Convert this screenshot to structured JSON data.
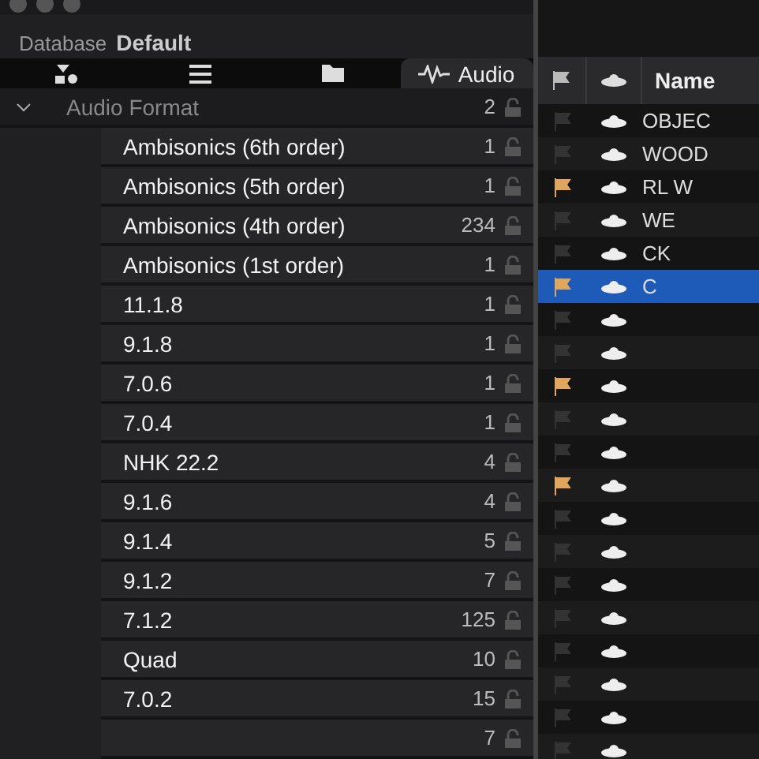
{
  "database": {
    "label": "Database",
    "value": "Default"
  },
  "tabs": [
    {
      "kind": "shapes",
      "selected": false
    },
    {
      "kind": "list",
      "selected": false
    },
    {
      "kind": "folder",
      "selected": false
    },
    {
      "kind": "audio",
      "label": "Audio",
      "selected": true
    }
  ],
  "tree": [
    {
      "label": "Audio Format",
      "count": "2",
      "expanded": true,
      "children": [
        {
          "label": "Ambisonics (6th order)",
          "count": "1"
        },
        {
          "label": "Ambisonics (5th order)",
          "count": "1"
        },
        {
          "label": "Ambisonics (4th order)",
          "count": "234"
        },
        {
          "label": "Ambisonics (1st order)",
          "count": "1"
        },
        {
          "label": "11.1.8",
          "count": "1"
        },
        {
          "label": "9.1.8",
          "count": "1"
        },
        {
          "label": "7.0.6",
          "count": "1"
        },
        {
          "label": "7.0.4",
          "count": "1"
        },
        {
          "label": "NHK 22.2",
          "count": "4"
        },
        {
          "label": "9.1.6",
          "count": "4"
        },
        {
          "label": "9.1.4",
          "count": "5"
        },
        {
          "label": "9.1.2",
          "count": "7"
        },
        {
          "label": "7.1.2",
          "count": "125"
        },
        {
          "label": "Quad",
          "count": "10"
        },
        {
          "label": "7.0.2",
          "count": "15"
        },
        {
          "count": "7"
        }
      ]
    }
  ],
  "table": {
    "columns": [
      {
        "kind": "flag"
      },
      {
        "kind": "cloud"
      },
      {
        "kind": "text",
        "label": "Name"
      }
    ],
    "rows": [
      {
        "flagged": false,
        "name": "OBJEC",
        "selected": false
      },
      {
        "flagged": false,
        "name": "WOOD",
        "selected": false
      },
      {
        "flagged": true,
        "name": "RL W",
        "selected": false
      },
      {
        "flagged": false,
        "name": "WE",
        "selected": false
      },
      {
        "flagged": false,
        "name": "CK",
        "selected": false
      },
      {
        "flagged": true,
        "name": "C",
        "selected": true
      },
      {
        "flagged": false,
        "selected": false
      },
      {
        "flagged": false,
        "selected": false
      },
      {
        "flagged": true,
        "selected": false
      },
      {
        "flagged": false,
        "selected": false
      },
      {
        "flagged": false,
        "selected": false
      },
      {
        "flagged": true,
        "selected": false
      },
      {
        "flagged": false,
        "selected": false
      },
      {
        "flagged": false,
        "selected": false
      },
      {
        "flagged": false,
        "selected": false
      },
      {
        "flagged": false,
        "selected": false
      },
      {
        "flagged": false,
        "selected": false
      },
      {
        "flagged": false,
        "selected": false
      },
      {
        "flagged": false,
        "selected": false
      },
      {
        "flagged": false,
        "selected": false
      }
    ]
  }
}
